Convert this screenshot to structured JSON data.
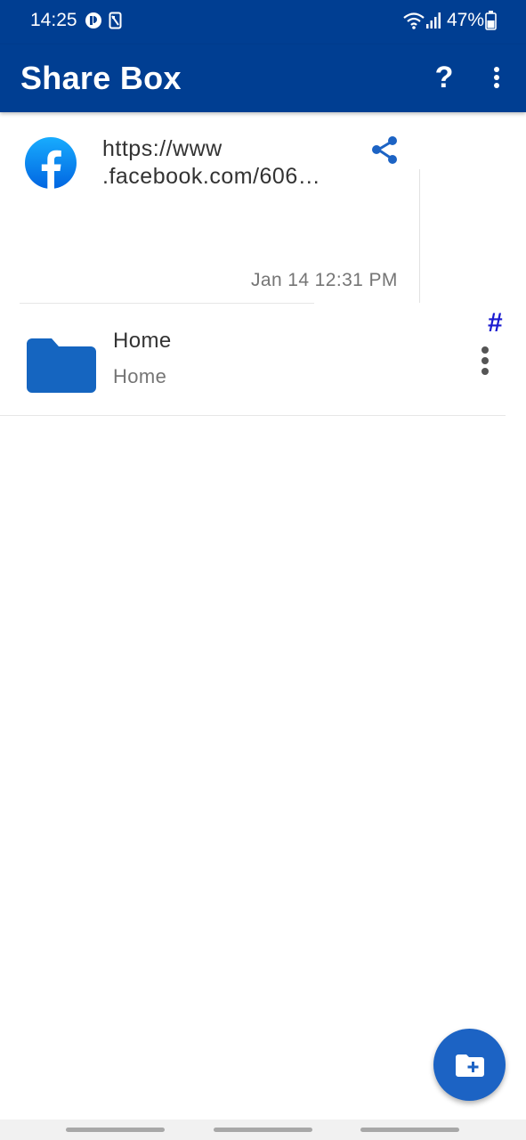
{
  "status_bar": {
    "time": "14:25",
    "battery": "47%"
  },
  "app_bar": {
    "title": "Share Box",
    "help_label": "?"
  },
  "link_item": {
    "url": "https://www\n.facebook.com/606…",
    "timestamp": "Jan 14 12:31 PM",
    "icon": "facebook-icon"
  },
  "hash_label": "#",
  "folder_item": {
    "name": "Home",
    "subtitle": "Home",
    "icon": "folder-icon"
  },
  "colors": {
    "primary": "#003e92",
    "accent": "#1c63c4",
    "folder": "#1565c0",
    "hash": "#1a1ad1"
  }
}
